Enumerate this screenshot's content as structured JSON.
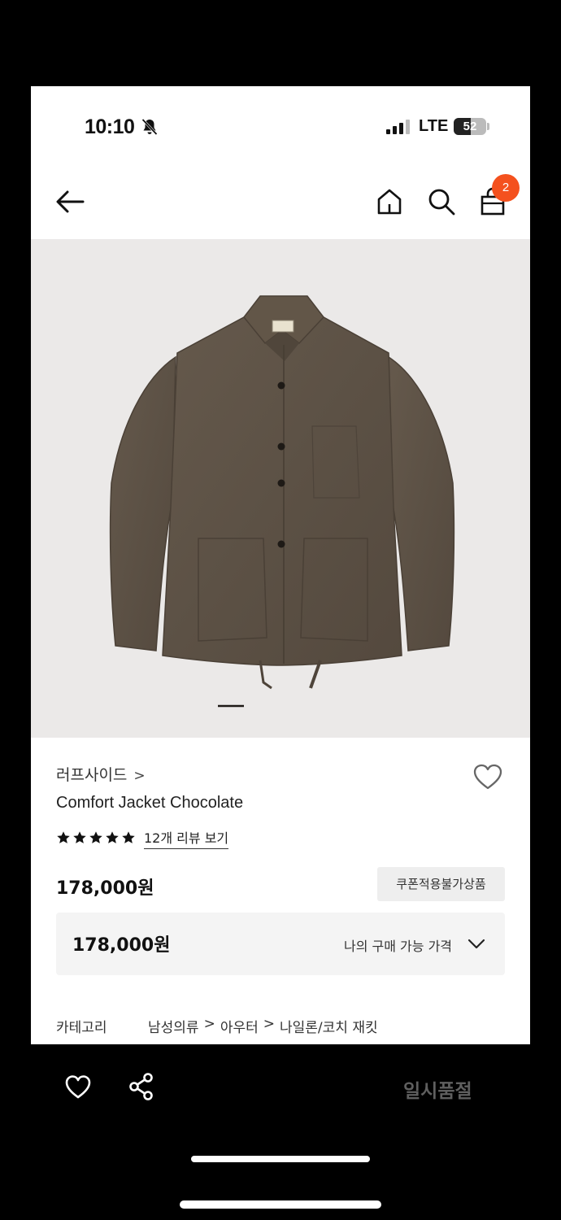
{
  "status_bar": {
    "time": "10:10",
    "network": "LTE",
    "battery_level": "52",
    "icons": [
      "bell-slash-icon",
      "signal-icon",
      "battery-icon"
    ]
  },
  "header": {
    "icons": [
      "back-arrow-icon",
      "home-icon",
      "search-icon",
      "shopping-bag-icon"
    ],
    "cart_count": "2"
  },
  "product": {
    "brand": "러프사이드",
    "brand_chevron": ">",
    "name": "Comfort Jacket Chocolate",
    "rating": 5,
    "review_link": "12개 리뷰 보기",
    "price": "178,000원",
    "coupon_note": "쿠폰적용불가상품",
    "my_price": {
      "value": "178,000원",
      "label": "나의 구매 가능 가격"
    },
    "category": {
      "label": "카테고리",
      "path": [
        "남성의류",
        "아우터",
        "나일론/코치 재킷"
      ],
      "separator": ">"
    },
    "image": {
      "subject": "jacket-image",
      "colors": {
        "background": "#ebe9e8",
        "jacket": "#5c5145"
      }
    }
  },
  "bottom_bar": {
    "icons": [
      "heart-icon",
      "share-icon"
    ],
    "status_label": "일시품절"
  },
  "colors": {
    "accent_badge": "#f4511e",
    "soldout_text": "#5f5f5f"
  }
}
